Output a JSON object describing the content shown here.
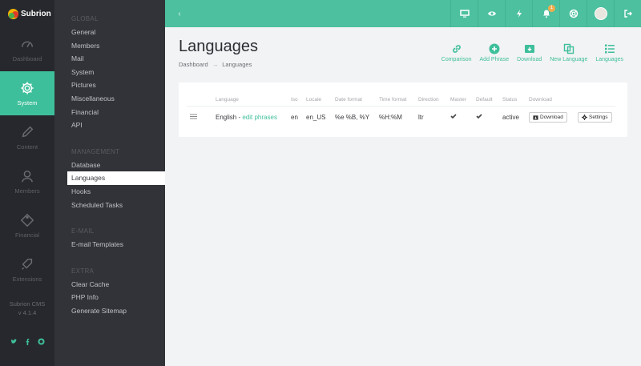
{
  "app": {
    "name": "Subrion",
    "version_line1": "Subrion CMS",
    "version_line2": "v 4.1.4"
  },
  "rail": [
    {
      "label": "Dashboard",
      "icon": "speedometer-icon"
    },
    {
      "label": "System",
      "icon": "gear-icon",
      "active": true
    },
    {
      "label": "Content",
      "icon": "pencil-icon"
    },
    {
      "label": "Members",
      "icon": "user-icon"
    },
    {
      "label": "Financial",
      "icon": "tag-icon"
    },
    {
      "label": "Extensions",
      "icon": "rocket-icon"
    }
  ],
  "subnav": {
    "global_title": "GLOBAL",
    "global": [
      "General",
      "Members",
      "Mail",
      "System",
      "Pictures",
      "Miscellaneous",
      "Financial",
      "API"
    ],
    "management_title": "MANAGEMENT",
    "management": [
      "Database",
      "Languages",
      "Hooks",
      "Scheduled Tasks"
    ],
    "email_title": "E-MAIL",
    "email": [
      "E-mail Templates"
    ],
    "extra_title": "EXTRA",
    "extra": [
      "Clear Cache",
      "PHP Info",
      "Generate Sitemap"
    ]
  },
  "topbar": {
    "back": "‹",
    "notification_count": "1"
  },
  "page": {
    "title": "Languages",
    "breadcrumb": [
      "Dashboard",
      "Languages"
    ],
    "breadcrumb_sep": "→"
  },
  "actions": [
    "Comparison",
    "Add Phrase",
    "Download",
    "New Language",
    "Languages"
  ],
  "table": {
    "headers": [
      "Language",
      "Iso",
      "Locale",
      "Date format",
      "Time format",
      "Direction",
      "Master",
      "Default",
      "Status",
      "Download",
      ""
    ],
    "row": {
      "language": "English",
      "sep": " - ",
      "edit": "edit phrases",
      "iso": "en",
      "locale": "en_US",
      "date_format": "%e %B, %Y",
      "time_format": "%H:%M",
      "direction": "ltr",
      "status": "active",
      "download_btn": "Download",
      "settings_btn": "Settings"
    }
  },
  "colors": {
    "accent": "#4cc09f",
    "rail": "#27282d",
    "subnav": "#323338"
  }
}
